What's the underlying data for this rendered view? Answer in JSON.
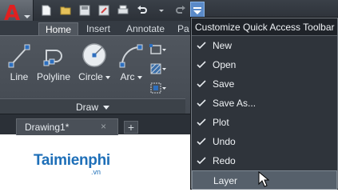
{
  "app": {
    "logo_letter": "A",
    "logo_color": "#e02020"
  },
  "quick_access": {
    "icons": [
      "new-icon",
      "open-icon",
      "save-icon",
      "save-as-icon",
      "plot-icon",
      "undo-icon",
      "redo-icon",
      "customize-dropdown-icon"
    ]
  },
  "ribbon": {
    "tabs": [
      {
        "label": "Home"
      },
      {
        "label": "Insert"
      },
      {
        "label": "Annotate"
      },
      {
        "label": "Pa"
      }
    ],
    "tools": {
      "line": "Line",
      "polyline": "Polyline",
      "circle": "Circle",
      "arc": "Arc"
    },
    "panel_title": "Draw"
  },
  "file_tabs": {
    "active": "Drawing1*",
    "close_glyph": "×",
    "add_glyph": "+"
  },
  "menu": {
    "title": "Customize Quick Access Toolbar",
    "items": [
      {
        "label": "New",
        "checked": true
      },
      {
        "label": "Open",
        "checked": true
      },
      {
        "label": "Save",
        "checked": true
      },
      {
        "label": "Save As...",
        "checked": true
      },
      {
        "label": "Plot",
        "checked": true
      },
      {
        "label": "Undo",
        "checked": true
      },
      {
        "label": "Redo",
        "checked": true
      },
      {
        "label": "Layer",
        "checked": false,
        "highlighted": true
      }
    ]
  },
  "watermark": {
    "text": "Taimienphi",
    "suffix": ".vn"
  },
  "colors": {
    "accent": "#5a8ac8",
    "menu_bg": "#2f343b",
    "watermark": "#1e6fb8"
  }
}
